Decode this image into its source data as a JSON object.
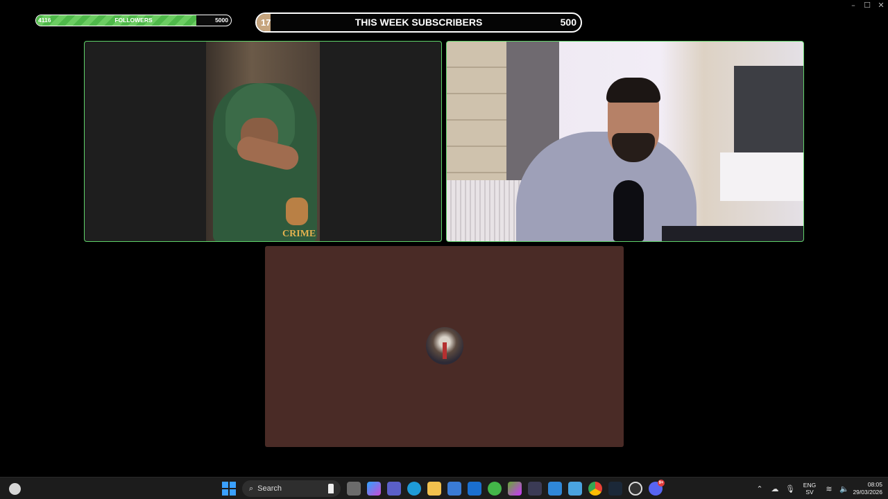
{
  "followers_bar": {
    "current": "4116",
    "label": "FOLLOWERS",
    "goal": "5000",
    "progress": 0.8232,
    "color": "#5cc453"
  },
  "subscribers_bar": {
    "current": "17",
    "label": "THIS WEEK SUBSCRIBERS",
    "goal": "500",
    "progress": 0.034,
    "color": "#c6a57e"
  },
  "tiles": [
    {
      "name": "participant-left",
      "kind": "video"
    },
    {
      "name": "participant-right",
      "kind": "video"
    },
    {
      "name": "participant-audio-only",
      "kind": "avatar",
      "background": "#4a2b26"
    }
  ],
  "left_tile_overlay_text": "CRIME",
  "taskbar": {
    "search_label": "Search",
    "apps": [
      "task-view-icon",
      "copilot-icon",
      "teams-icon",
      "edge-icon",
      "file-explorer-icon",
      "store-icon",
      "outlook-icon",
      "vpn-shield-icon",
      "app-icon",
      "hexagon-app-icon",
      "photos-icon",
      "gallery-icon",
      "chrome-icon",
      "steam-icon",
      "obs-icon",
      "discord-icon"
    ],
    "discord_badge": "9+",
    "tray": {
      "lang_top": "ENG",
      "lang_bottom": "SV",
      "time": "08:05",
      "date": "29/03/2026"
    }
  },
  "window_controls": {
    "minimize": "–",
    "maximize": "☐",
    "close": "✕"
  }
}
